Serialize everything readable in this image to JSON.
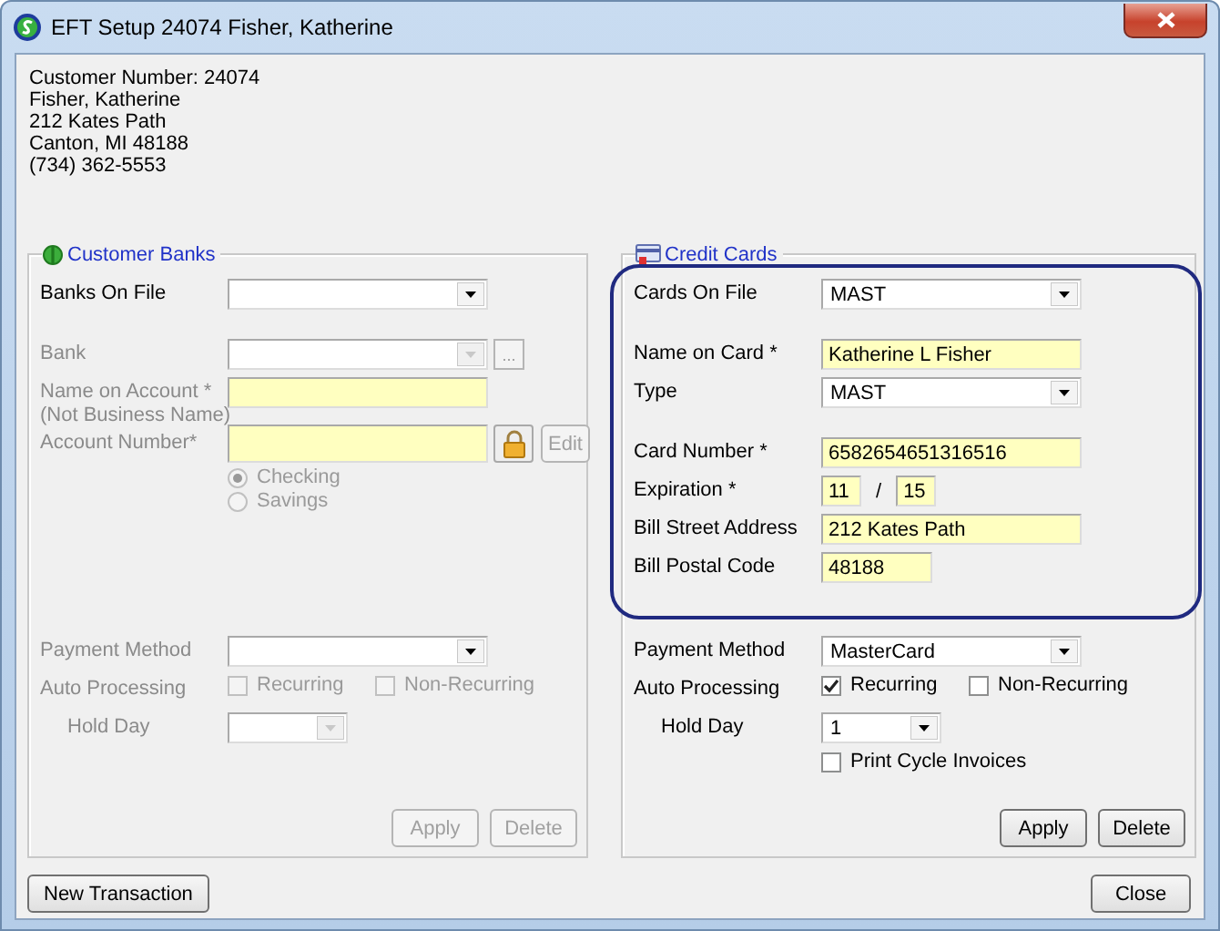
{
  "window": {
    "title": "EFT Setup 24074 Fisher, Katherine"
  },
  "customer": [
    "Customer Number: 24074",
    "Fisher, Katherine",
    "212  Kates Path",
    "Canton, MI  48188",
    "(734) 362-5553"
  ],
  "panels": [
    {
      "kind": "banks",
      "title": "Customer Banks",
      "highlighted": false,
      "groups": [
        [
          {
            "kind": "combo",
            "label": "Banks On File",
            "disabled": false
          }
        ],
        [
          {
            "kind": "combo_browse",
            "label": "Bank",
            "browse": "...",
            "disabled": true
          },
          {
            "kind": "text",
            "label": "Name on Account *",
            "sublabel": "(Not Business Name)",
            "disabled": true
          },
          {
            "kind": "text_lock",
            "label": "Account Number*",
            "edit": "Edit",
            "disabled": true
          },
          {
            "kind": "radios",
            "disabled": true,
            "options": [
              {
                "label": "Checking",
                "selected": true
              },
              {
                "label": "Savings",
                "selected": false
              }
            ]
          }
        ]
      ],
      "processing": [
        {
          "kind": "combo",
          "label": "Payment Method",
          "disabled": true
        },
        {
          "kind": "checks",
          "label": "Auto Processing",
          "disabled": true,
          "options": [
            {
              "label": "Recurring",
              "checked": false
            },
            {
              "label": "Non-Recurring",
              "checked": false
            }
          ]
        },
        {
          "kind": "small_combo",
          "label": "Hold Day",
          "disabled": true
        }
      ],
      "buttons": [
        {
          "label": "Apply",
          "disabled": true
        },
        {
          "label": "Delete",
          "disabled": true
        }
      ]
    },
    {
      "kind": "cards",
      "title": "Credit Cards",
      "highlighted": true,
      "groups": [
        [
          {
            "kind": "combo",
            "label": "Cards On File",
            "value": "MAST",
            "disabled": false
          }
        ],
        [
          {
            "kind": "text",
            "label": "Name on Card *",
            "value": "Katherine L Fisher",
            "disabled": false
          },
          {
            "kind": "combo",
            "label": "Type",
            "value": "MAST",
            "disabled": false
          }
        ],
        [
          {
            "kind": "text",
            "label": "Card Number *",
            "value": "6582654651316516",
            "disabled": false
          },
          {
            "kind": "expiry",
            "label": "Expiration *",
            "month": "11",
            "separator": "/",
            "year": "15",
            "disabled": false
          },
          {
            "kind": "text",
            "label": "Bill Street Address",
            "value": "212  Kates Path",
            "disabled": false
          },
          {
            "kind": "short_text",
            "label": "Bill Postal Code",
            "value": "48188",
            "disabled": false
          }
        ]
      ],
      "processing": [
        {
          "kind": "combo",
          "label": "Payment Method",
          "value": "MasterCard",
          "disabled": false
        },
        {
          "kind": "checks",
          "label": "Auto Processing",
          "disabled": false,
          "options": [
            {
              "label": "Recurring",
              "checked": true
            },
            {
              "label": "Non-Recurring",
              "checked": false
            }
          ]
        },
        {
          "kind": "small_combo",
          "label": "Hold Day",
          "value": "1",
          "disabled": false
        },
        {
          "kind": "checks",
          "disabled": false,
          "options": [
            {
              "label": "Print Cycle Invoices",
              "checked": false
            }
          ]
        }
      ],
      "buttons": [
        {
          "label": "Apply",
          "disabled": false
        },
        {
          "label": "Delete",
          "disabled": false
        }
      ]
    }
  ],
  "footer": [
    {
      "label": "New Transaction"
    },
    {
      "label": "Close"
    }
  ]
}
